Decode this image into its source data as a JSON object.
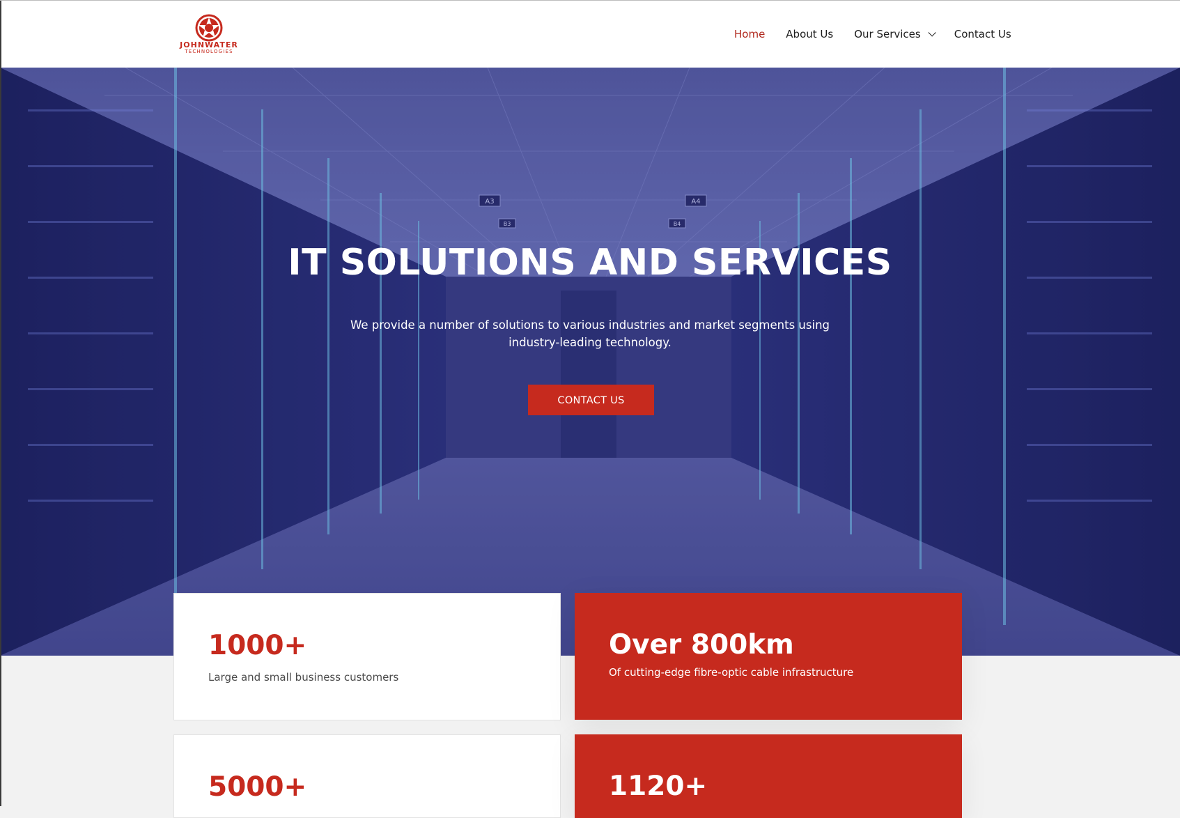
{
  "brand": {
    "name": "JOHNWATER",
    "tagline": "TECHNOLOGIES",
    "accent": "#c62a1e"
  },
  "nav": {
    "items": [
      {
        "label": "Home",
        "active": true
      },
      {
        "label": "About Us",
        "active": false
      },
      {
        "label": "Our Services",
        "active": false,
        "icon": "chevron-down-icon"
      },
      {
        "label": "Contact Us",
        "active": false
      }
    ]
  },
  "hero": {
    "title": "IT SOLUTIONS AND SERVICES",
    "subtitle": "We provide a number of solutions to various industries and market segments using industry-leading technology.",
    "cta_label": "CONTACT US",
    "signs": [
      "A3",
      "A4",
      "B3",
      "B4"
    ]
  },
  "stats": [
    {
      "value": "1000+",
      "description": "Large and small business customers",
      "style": "white"
    },
    {
      "value": "Over 800km",
      "description": "Of cutting-edge fibre-optic cable infrastructure",
      "style": "red"
    },
    {
      "value": "5000+",
      "description": "",
      "style": "white"
    },
    {
      "value": "1120+",
      "description": "",
      "style": "red"
    }
  ]
}
